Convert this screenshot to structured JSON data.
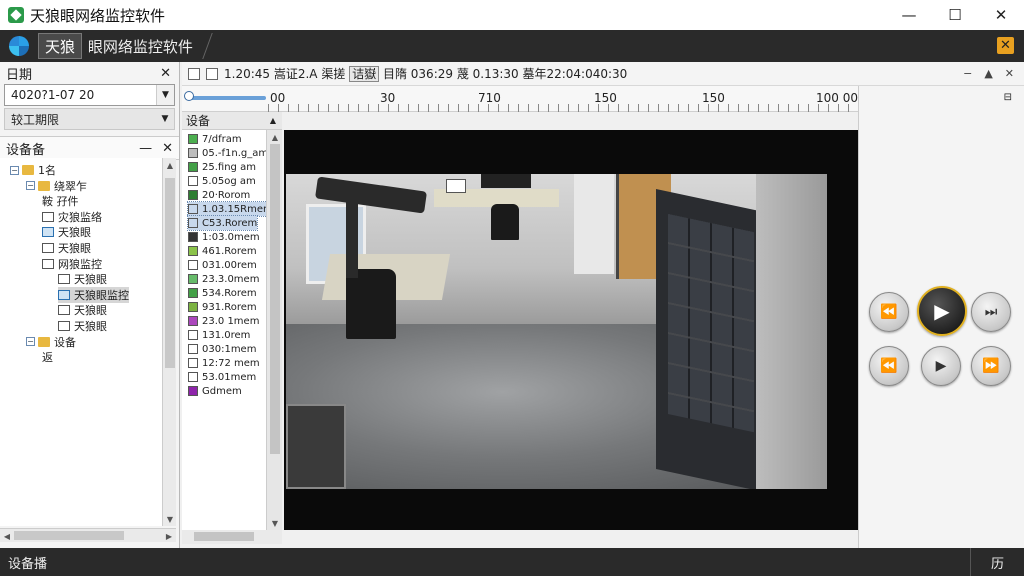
{
  "window": {
    "title": "天狼眼网络监控软件",
    "min": "—",
    "max": "☐",
    "close": "✕"
  },
  "tabs": {
    "active": "天狼",
    "rest": "眼网络监控软件",
    "close_icon": "✕"
  },
  "left_panel": {
    "date_label": "日期",
    "date_value": "4020?1-07 20",
    "select_value": "较工期限",
    "devices_label": "设备备",
    "close": "✕",
    "min": "—",
    "tree": [
      {
        "label": "1名",
        "indent": 0,
        "icon": "folder",
        "expander": "−"
      },
      {
        "label": "绕翠乍",
        "indent": 1,
        "icon": "folder",
        "expander": "−"
      },
      {
        "label": "鞍 孖件",
        "indent": 2,
        "icon": "none"
      },
      {
        "label": "灾狼监络",
        "indent": 2,
        "icon": "cam"
      },
      {
        "label": "天狼眼",
        "indent": 2,
        "icon": "cam-blue"
      },
      {
        "label": "天狼眼",
        "indent": 2,
        "icon": "cam"
      },
      {
        "label": "网狼监控",
        "indent": 2,
        "icon": "cam"
      },
      {
        "label": "天狼眼",
        "indent": 3,
        "icon": "cam"
      },
      {
        "label": "天狼眼监控",
        "indent": 3,
        "icon": "cam-blue",
        "selected": true
      },
      {
        "label": "天狼眼",
        "indent": 3,
        "icon": "cam"
      },
      {
        "label": "天狼眼",
        "indent": 3,
        "icon": "cam"
      },
      {
        "label": "设备",
        "indent": 1,
        "icon": "folder",
        "expander": "−"
      },
      {
        "label": "返",
        "indent": 2,
        "icon": "none"
      }
    ]
  },
  "toolbar": {
    "text_prefix": "1.20:45  嵩证2.A  渠搓 ",
    "text_hl": "诘嶽",
    "text_suffix": "  目隋 036:29  蔑 0.13:30  墓年22:04:040:30",
    "right_icons": [
      "−",
      "▲",
      "✕"
    ]
  },
  "timeline": {
    "labels": [
      "00",
      "30",
      "710",
      "150",
      "150",
      "100 00"
    ],
    "pin": "⊟"
  },
  "device_list": {
    "header": "设备",
    "items": [
      {
        "label": "7/dfram",
        "color": "#4caf50"
      },
      {
        "label": "05.-f1n.g_am",
        "color": "#bdbdbd"
      },
      {
        "label": "25.fing am",
        "color": "#43a047"
      },
      {
        "label": "5.05og am",
        "color": "#ffffff"
      },
      {
        "label": "20·Rorom",
        "color": "#2e7d32"
      },
      {
        "label": "1.03.15Rmen",
        "color": "#c8d8ec",
        "sel": true
      },
      {
        "label": "C53.Rorem",
        "color": "#c8d8ec",
        "sel": true
      },
      {
        "label": "1:03.0mem",
        "color": "#333333"
      },
      {
        "label": "461.Rorem",
        "color": "#8bc34a"
      },
      {
        "label": "031.00rem",
        "color": "#ffffff"
      },
      {
        "label": "23.3.0mem",
        "color": "#66bb6a"
      },
      {
        "label": "534.Rorem",
        "color": "#43a047"
      },
      {
        "label": "931.Rorem",
        "color": "#7cb342"
      },
      {
        "label": "23.0 1mem",
        "color": "#ab47bc"
      },
      {
        "label": "131.0rem",
        "color": "#ffffff"
      },
      {
        "label": "030:1mem",
        "color": "#ffffff"
      },
      {
        "label": "12:72 mem",
        "color": "#ffffff"
      },
      {
        "label": "53.01mem",
        "color": "#ffffff"
      },
      {
        "label": "Gdmem",
        "color": "#8e24aa"
      }
    ]
  },
  "controls": {
    "row1": [
      "⏪",
      "▶",
      "⏭"
    ],
    "row2": [
      "⏪",
      "▶",
      "⏩"
    ]
  },
  "status": {
    "left": "设备播",
    "right": "历"
  }
}
